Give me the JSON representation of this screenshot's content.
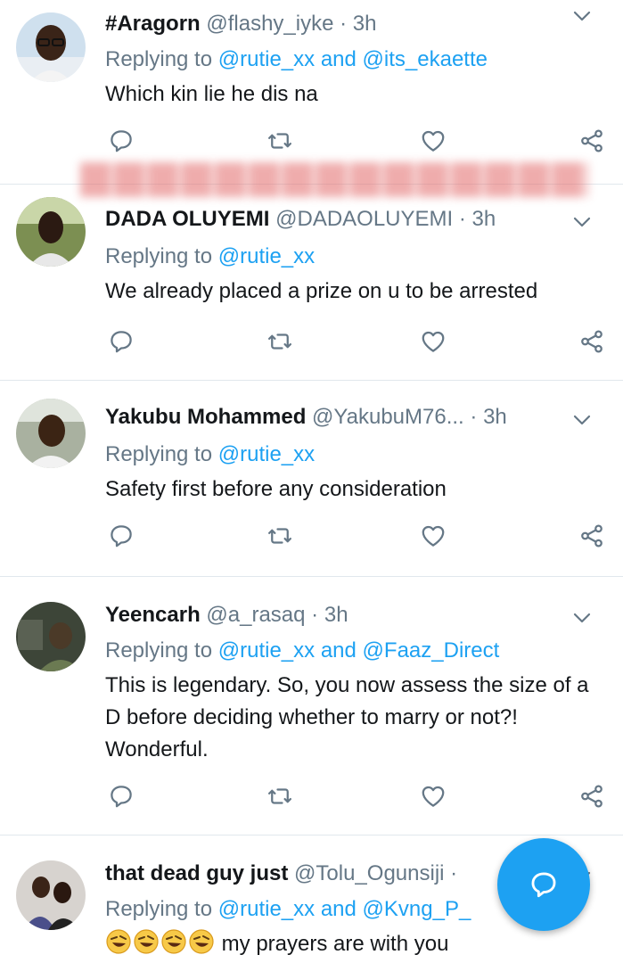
{
  "colors": {
    "accent": "#1da1f2",
    "muted": "#657786",
    "text": "#14171a",
    "divider": "#e1e8ed"
  },
  "icons": {
    "reply": "reply-icon",
    "retweet": "retweet-icon",
    "like": "heart-icon",
    "share": "share-icon",
    "menu": "chevron-down-icon",
    "compose": "compose-reply-icon"
  },
  "tweets": [
    {
      "name": "#Aragorn",
      "handle": "@flashy_iyke",
      "dot": "·",
      "time": "3h",
      "replying_prefix": "Replying to",
      "mentions": [
        "@rutie_xx",
        "@its_ekaette"
      ],
      "joiner": "and",
      "text": "Which kin lie he dis na"
    },
    {
      "name": "DADA OLUYEMI",
      "handle": "@DADAOLUYEMI",
      "dot": "·",
      "time": "3h",
      "replying_prefix": "Replying to",
      "mentions": [
        "@rutie_xx"
      ],
      "text": "We already placed a prize on u to be arrested"
    },
    {
      "name": "Yakubu Mohammed",
      "handle": "@YakubuM76...",
      "dot": "·",
      "time": "3h",
      "replying_prefix": "Replying to",
      "mentions": [
        "@rutie_xx"
      ],
      "text": "Safety first before any consideration"
    },
    {
      "name": "Yeencarh",
      "handle": "@a_rasaq",
      "dot": "·",
      "time": "3h",
      "replying_prefix": "Replying to",
      "mentions": [
        "@rutie_xx",
        "@Faaz_Direct"
      ],
      "joiner": "and",
      "text": "This is legendary. So, you now assess the size of a D before deciding whether to marry or not?! Wonderful."
    },
    {
      "name": "that dead guy just",
      "handle": "@Tolu_Ogunsiji",
      "dot": "·",
      "replying_prefix": "Replying to",
      "mentions": [
        "@rutie_xx",
        "@Kvng_P_"
      ],
      "joiner": "and",
      "emoji": [
        "🤣",
        "🤣",
        "🤣",
        "🤣"
      ],
      "text": "my prayers are with you"
    }
  ]
}
